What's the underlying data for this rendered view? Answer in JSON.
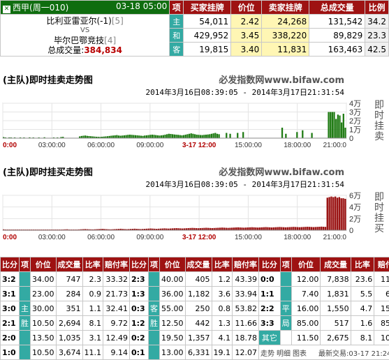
{
  "match": {
    "league": "西甲",
    "round": "(周一010)",
    "datetime": "03-18 05:00",
    "home": "比利亚雷亚尔(-1)",
    "home_rank": "[5]",
    "vs": "VS",
    "away": "毕尔巴鄂竞技",
    "away_rank": "[4]",
    "total_label": "总成交量:",
    "total_value": "384,834"
  },
  "top_table": {
    "headers": [
      "项",
      "买家挂牌",
      "价位",
      "卖家挂牌",
      "总成交量",
      "比例"
    ],
    "rows": [
      {
        "item": "主",
        "buy": "54,011",
        "price": "2.42",
        "sell": "24,268",
        "total": "131,542",
        "ratio": "34.2"
      },
      {
        "item": "和",
        "buy": "429,952",
        "price": "3.45",
        "sell": "338,220",
        "total": "89,829",
        "ratio": "23.3"
      },
      {
        "item": "客",
        "buy": "19,815",
        "price": "3.40",
        "sell": "11,831",
        "total": "163,463",
        "ratio": "42.5"
      }
    ]
  },
  "charts": [
    {
      "title": "(主队)即时挂卖走势图",
      "site": "必发指数网www.bifaw.com",
      "range": "2014年3月16日08:39:05 - 2014年3月17日21:31:54",
      "vertical_label": "即时挂卖",
      "y_ticks": [
        "4万",
        "3万",
        "2万",
        "1万",
        "0"
      ],
      "x_ticks": [
        "0:00",
        "03:00:00",
        "06:00:00",
        "09:00:00",
        "3-17 12:00",
        "15:00:00",
        "18:00:00",
        "21:00:0"
      ]
    },
    {
      "title": "(主队)即时挂买走势图",
      "site": "必发指数网www.bifaw.com",
      "range": "2014年3月16日08:39:05 - 2014年3月17日21:31:54",
      "vertical_label": "即时挂买",
      "y_ticks": [
        "6万",
        "4万",
        "2万",
        "0"
      ],
      "x_ticks": [
        "0:00",
        "03:00:00",
        "06:00:00",
        "09:00:00",
        "3-17 12:00",
        "15:00:00",
        "18:00:00",
        "21:00:0"
      ]
    }
  ],
  "chart_data": [
    {
      "type": "bar",
      "title": "(主队)即时挂卖走势图",
      "ylabel": "即时挂卖",
      "ylim": [
        0,
        40000
      ],
      "color": "#1e7a12",
      "values": [
        1200,
        300,
        0,
        800,
        400,
        0,
        200,
        0,
        0,
        600,
        0,
        300,
        0,
        0,
        900,
        0,
        400,
        0,
        0,
        300,
        0,
        0,
        1000,
        0,
        0,
        0,
        0,
        200,
        0,
        500,
        0,
        1300,
        1500,
        0,
        0,
        0,
        0,
        0,
        0,
        0,
        0,
        2000,
        2500,
        2800,
        3000,
        2600,
        2400,
        2200,
        2000,
        1800,
        1600,
        1500,
        1400,
        1600,
        1800,
        2000,
        2200,
        2500,
        2800,
        3000,
        3200,
        3500,
        3000,
        2800,
        3000,
        3200,
        3500,
        3800,
        4000,
        3800,
        3600,
        3400,
        3200,
        3000,
        2800,
        2600,
        3000,
        3200,
        3500,
        3800,
        4000,
        3800,
        3500,
        3200,
        3000,
        3200,
        3500,
        4000,
        4500,
        5000,
        4800,
        4500,
        4200,
        4000,
        3800,
        3500,
        3200,
        3500,
        4000,
        4500,
        5000,
        5500,
        5000,
        4500,
        4000,
        3800,
        3600,
        3500,
        3800,
        4000,
        4200,
        4500,
        5000,
        5500,
        6000,
        5000,
        4500,
        0,
        0,
        0,
        6000,
        0,
        5000,
        0,
        0,
        0,
        6000,
        0,
        0,
        7000,
        0,
        0,
        0,
        0,
        0,
        0,
        0,
        0,
        0,
        0,
        0,
        0,
        0,
        0,
        0,
        0,
        0,
        0,
        0,
        0,
        12000,
        0,
        5000,
        0,
        0,
        0,
        0,
        0,
        7000,
        0,
        0,
        9000,
        0,
        0,
        0,
        0,
        6000,
        0,
        0,
        0,
        0,
        0,
        0,
        0,
        0,
        30000,
        30000,
        30000,
        30000,
        22000,
        27000,
        26000,
        18000,
        28000,
        12000
      ]
    },
    {
      "type": "bar",
      "title": "(主队)即时挂买走势图",
      "ylabel": "即时挂买",
      "ylim": [
        0,
        60000
      ],
      "color": "#9a1414",
      "values": [
        1500,
        800,
        500,
        1000,
        600,
        300,
        800,
        400,
        600,
        900,
        500,
        700,
        400,
        600,
        800,
        1000,
        500,
        600,
        700,
        800,
        1000,
        1200,
        900,
        1000,
        800,
        700,
        900,
        1000,
        1100,
        1200,
        1300,
        1500,
        1600,
        1200,
        1000,
        900,
        1100,
        1200,
        1400,
        1600,
        1800,
        2000,
        1800,
        1600,
        1500,
        1400,
        1600,
        1800,
        2000,
        2200,
        2400,
        2000,
        1800,
        1600,
        1500,
        1700,
        1900,
        2100,
        2300,
        2500,
        2200,
        2000,
        1800,
        2000,
        2200,
        2400,
        2600,
        2400,
        2200,
        2000,
        2200,
        2400,
        2600,
        2800,
        3000,
        2800,
        2600,
        2400,
        2600,
        2800,
        3000,
        3200,
        3000,
        2800,
        3000,
        3200,
        3400,
        3600,
        3400,
        3200,
        3000,
        3200,
        3400,
        3600,
        3800,
        4000,
        3800,
        3600,
        3400,
        3600,
        3800,
        4000,
        4200,
        4000,
        3800,
        3600,
        3800,
        4000,
        4200,
        4400,
        4600,
        4400,
        4200,
        4000,
        4200,
        4400,
        4600,
        4800,
        5000,
        4800,
        4600,
        4400,
        4600,
        4800,
        5000,
        5200,
        5000,
        4800,
        4600,
        4800,
        5000,
        5200,
        5400,
        5200,
        5000,
        4800,
        5000,
        5200,
        5400,
        5600,
        5400,
        5200,
        5000,
        5200,
        5400,
        5600,
        5800,
        5600,
        5400,
        5200,
        5400,
        5600,
        5800,
        6000,
        5800,
        5600,
        5400,
        5600,
        5800,
        6000,
        6200,
        6000,
        5800,
        56000,
        57000,
        58000,
        57000,
        58000,
        56000,
        57000,
        55000,
        55000,
        54000
      ]
    }
  ],
  "bottom_table": {
    "headers": [
      "比分",
      "项",
      "价位",
      "成交量",
      "比率",
      "赔付率",
      "比分",
      "项",
      "价位",
      "成交量",
      "比率",
      "赔付率",
      "比分",
      "项",
      "价位",
      "成交量",
      "比率",
      "赔付率"
    ],
    "home_rows": [
      [
        "3:2",
        "34.00",
        "747",
        "2.3",
        "33.32"
      ],
      [
        "3:1",
        "23.00",
        "284",
        "0.9",
        "21.73"
      ],
      [
        "3:0",
        "30.00",
        "351",
        "1.1",
        "32.41"
      ],
      [
        "2:1",
        "10.50",
        "2,694",
        "8.1",
        "9.72"
      ],
      [
        "2:0",
        "13.50",
        "1,035",
        "3.1",
        "12.49"
      ],
      [
        "1:0",
        "10.50",
        "3,674",
        "11.1",
        "9.14"
      ]
    ],
    "home_item": [
      "主",
      "胜"
    ],
    "away_rows": [
      [
        "2:3",
        "40.00",
        "405",
        "1.2",
        "43.39"
      ],
      [
        "1:3",
        "36.00",
        "1,182",
        "3.6",
        "33.94"
      ],
      [
        "0:3",
        "55.00",
        "250",
        "0.8",
        "53.82"
      ],
      [
        "1:2",
        "12.50",
        "442",
        "1.3",
        "11.66"
      ],
      [
        "0:2",
        "19.50",
        "1,357",
        "4.1",
        "18.78"
      ],
      [
        "0:1",
        "13.00",
        "6,331",
        "19.1",
        "12.07"
      ]
    ],
    "away_item": [
      "客",
      "胜"
    ],
    "draw_rows": [
      [
        "0:0",
        "12.00",
        "7,838",
        "23.6",
        "11.41"
      ],
      [
        "1:1",
        "7.40",
        "1,831",
        "5.5",
        "6.35"
      ],
      [
        "2:2",
        "16.00",
        "1,550",
        "4.7",
        "15.45"
      ],
      [
        "3:3",
        "85.00",
        "517",
        "1.6",
        "85.91"
      ],
      [
        "",
        "11.50",
        "2,675",
        "8.1",
        "10.97"
      ]
    ],
    "draw_item": [
      "平",
      "局"
    ],
    "other_label": "其它",
    "footer_links": [
      "走势",
      "明细",
      "图表"
    ],
    "latest_trade": "最新交易:03-17 21:24:21"
  },
  "colors": {
    "header_red": "#9e1212",
    "teal": "#33aaa3",
    "sell_green": "#1e7a12",
    "buy_red": "#9a1414",
    "highlight_yellow": "#fff6b4"
  }
}
